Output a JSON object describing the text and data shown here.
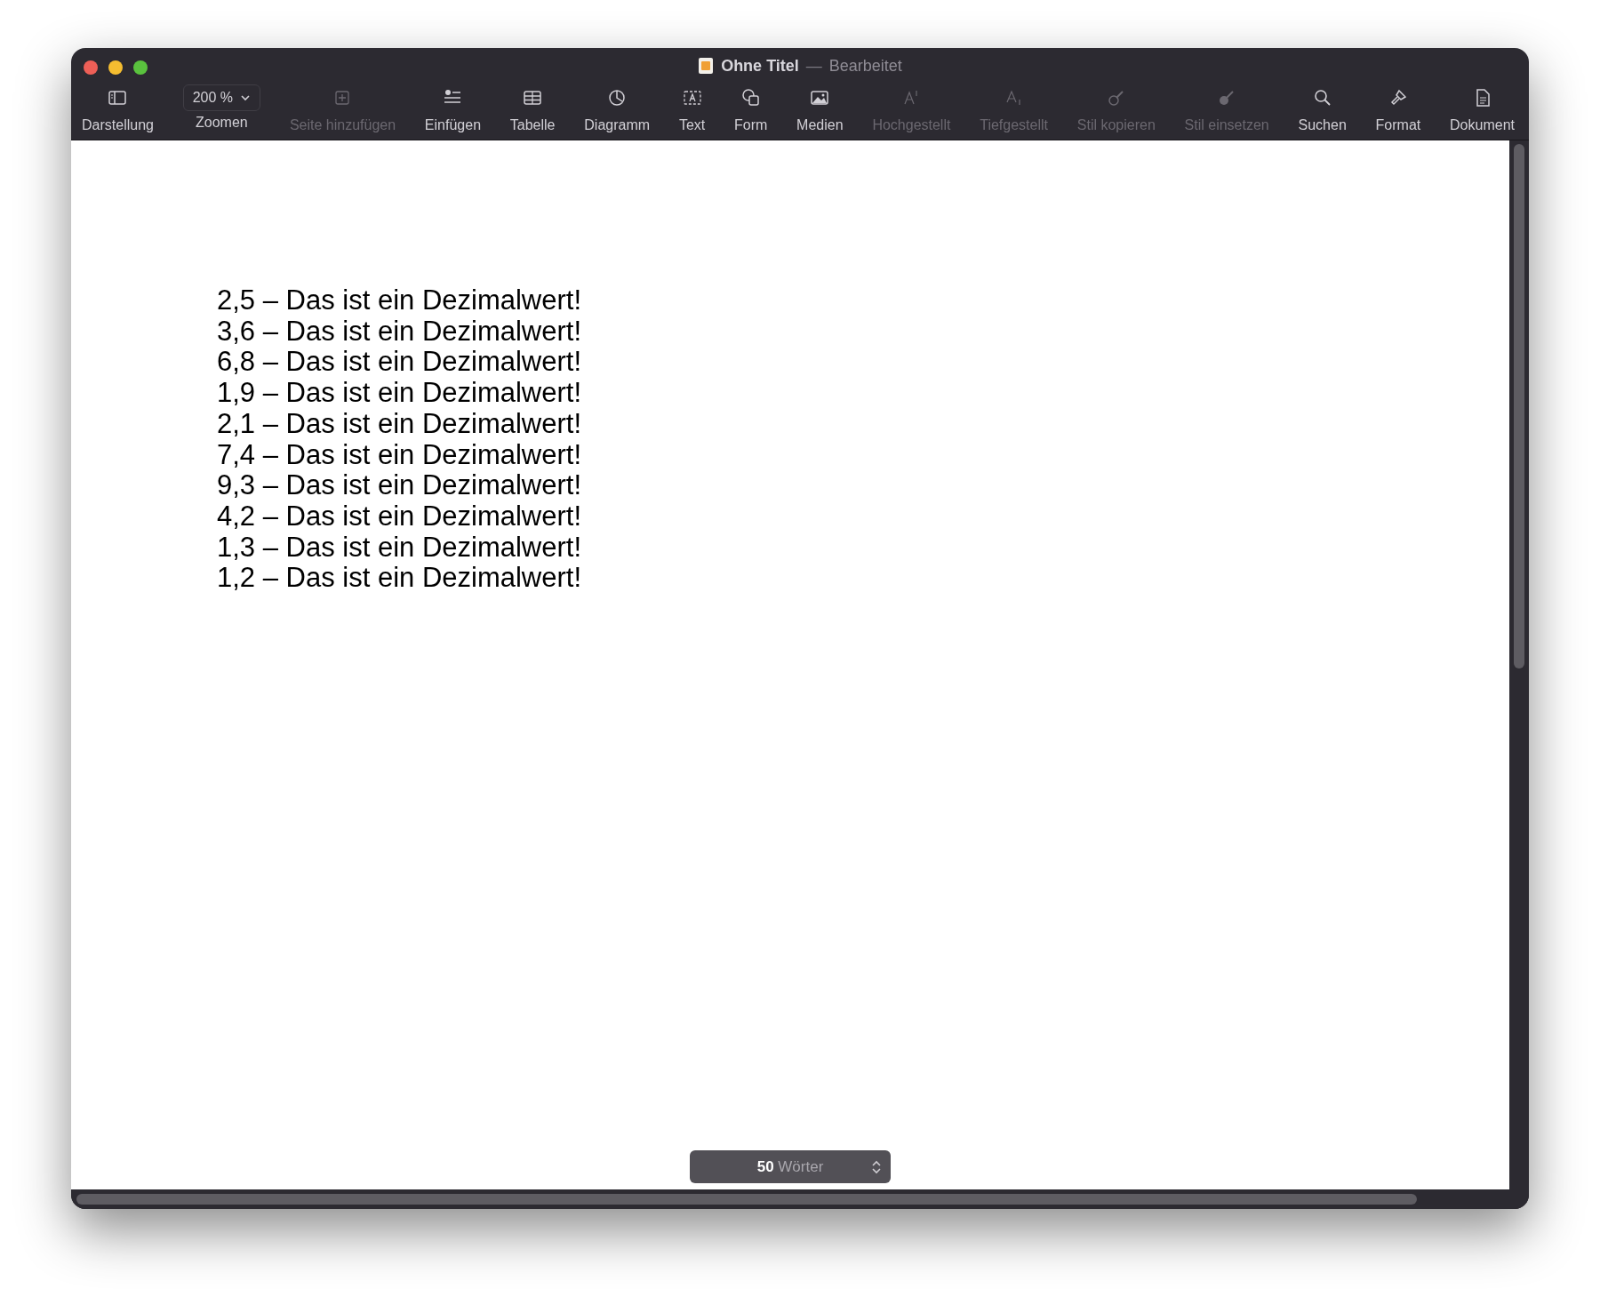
{
  "window": {
    "title": "Ohne Titel",
    "separator": "—",
    "status": "Bearbeitet"
  },
  "toolbar": [
    {
      "label": "Darstellung",
      "kind": "button",
      "disabled": false
    },
    {
      "label": "Zoomen",
      "kind": "zoom",
      "value": "200 %"
    },
    {
      "label": "Seite hinzufügen",
      "kind": "button",
      "disabled": true
    },
    {
      "label": "Einfügen",
      "kind": "button",
      "disabled": false
    },
    {
      "label": "Tabelle",
      "kind": "button",
      "disabled": false
    },
    {
      "label": "Diagramm",
      "kind": "button",
      "disabled": false
    },
    {
      "label": "Text",
      "kind": "button",
      "disabled": false
    },
    {
      "label": "Form",
      "kind": "button",
      "disabled": false
    },
    {
      "label": "Medien",
      "kind": "button",
      "disabled": false
    },
    {
      "label": "Hochgestellt",
      "kind": "button",
      "disabled": true
    },
    {
      "label": "Tiefgestellt",
      "kind": "button",
      "disabled": true
    },
    {
      "label": "Stil kopieren",
      "kind": "button",
      "disabled": true
    },
    {
      "label": "Stil einsetzen",
      "kind": "button",
      "disabled": true
    },
    {
      "label": "Suchen",
      "kind": "button",
      "disabled": false
    },
    {
      "label": "Format",
      "kind": "button",
      "disabled": false
    },
    {
      "label": "Dokument",
      "kind": "button",
      "disabled": false
    }
  ],
  "document": {
    "lines": [
      "2,5 – Das ist ein Dezimalwert!",
      "3,6 – Das ist ein Dezimalwert!",
      "6,8 – Das ist ein Dezimalwert!",
      "1,9 – Das ist ein Dezimalwert!",
      "2,1 – Das ist ein Dezimalwert!",
      "7,4 – Das ist ein Dezimalwert!",
      "9,3 – Das ist ein Dezimalwert!",
      "4,2 – Das ist ein Dezimalwert!",
      "1,3 – Das ist ein Dezimalwert!",
      "1,2 – Das ist ein Dezimalwert!"
    ]
  },
  "word_count": "**50** Wörter"
}
